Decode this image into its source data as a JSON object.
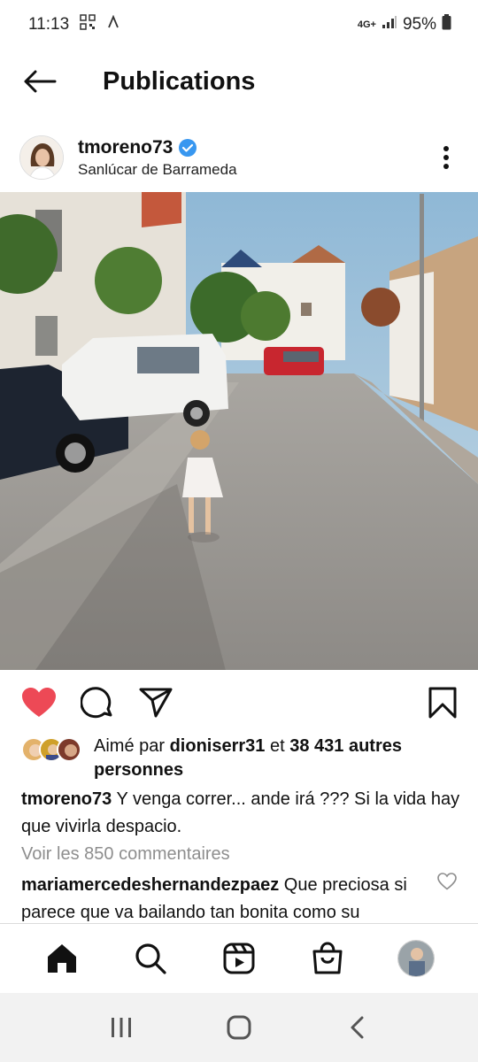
{
  "status_bar": {
    "time": "11:13",
    "network": "4G+",
    "battery": "95%"
  },
  "header": {
    "title": "Publications"
  },
  "post": {
    "username": "tmoreno73",
    "verified": true,
    "location": "Sanlúcar de Barrameda",
    "likes": {
      "prefix": "Aimé par ",
      "liker": "dioniserr31",
      "connector": " et ",
      "count": "38 431 autres personnes"
    },
    "caption": {
      "username": "tmoreno73",
      "text": " Y venga correr... ande irá ??? Si la vida hay que vivirla despacio."
    },
    "view_comments": "Voir les 850 commentaires",
    "comment": {
      "username": "mariamercedeshernandezpaez",
      "text": " Que preciosa si parece que va bailando tan bonita como su"
    },
    "liked": true
  },
  "colors": {
    "like_red": "#ed4956",
    "verified_blue": "#3897f0",
    "muted": "#8e8e8e"
  },
  "icons": {
    "status": [
      "qr-code-icon",
      "navigation-icon",
      "signal-icon",
      "battery-icon"
    ],
    "actions": [
      "heart-icon",
      "comment-icon",
      "share-icon",
      "bookmark-icon"
    ],
    "bottom_nav": [
      "home-icon",
      "search-icon",
      "reels-icon",
      "shop-icon",
      "profile-avatar"
    ],
    "system_nav": [
      "recents-icon",
      "home-circle-icon",
      "back-chevron-icon"
    ]
  }
}
